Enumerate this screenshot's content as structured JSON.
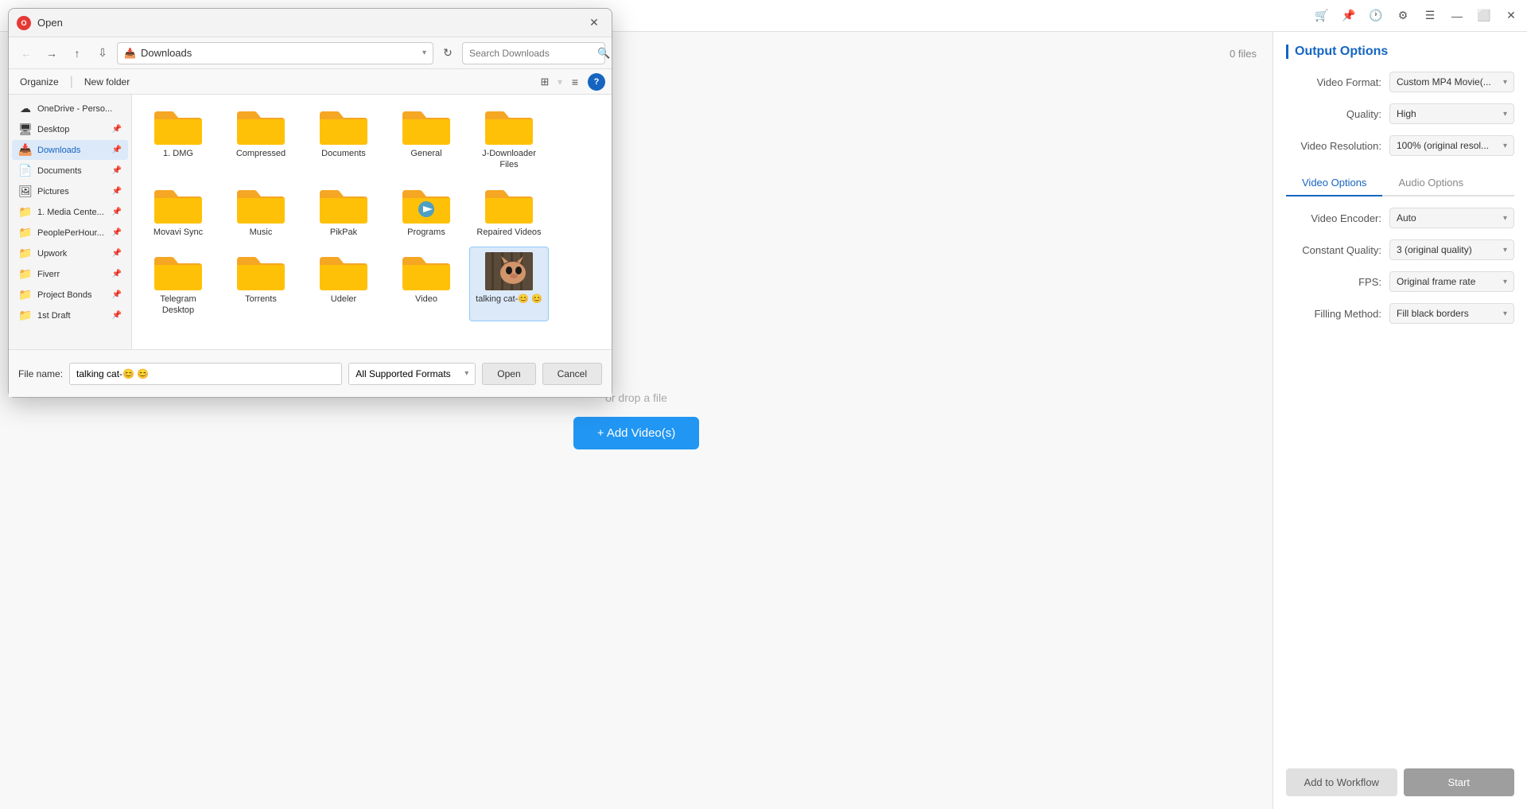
{
  "app": {
    "title": "Open",
    "titlebar_icons": [
      "cart-icon",
      "pin-icon",
      "clock-icon",
      "gear-icon",
      "menu-icon",
      "minimize-icon",
      "restore-icon",
      "close-icon"
    ]
  },
  "dialog": {
    "title": "Open",
    "app_icon": "O",
    "address": {
      "path": "Downloads",
      "icon": "📥"
    },
    "search_placeholder": "Search Downloads",
    "actions": {
      "organize": "Organize",
      "new_folder": "New folder"
    },
    "footer": {
      "filename_label": "File name:",
      "filename_value": "talking cat-😊 😊",
      "format_label": "All Supported Formats",
      "open_btn": "Open",
      "cancel_btn": "Cancel"
    }
  },
  "sidebar": {
    "items": [
      {
        "label": "OneDrive - Perso...",
        "icon": "☁",
        "pinned": false,
        "active": false
      },
      {
        "label": "Desktop",
        "icon": "🖥",
        "pinned": true,
        "active": false
      },
      {
        "label": "Downloads",
        "icon": "📥",
        "pinned": true,
        "active": true
      },
      {
        "label": "Documents",
        "icon": "📄",
        "pinned": true,
        "active": false
      },
      {
        "label": "Pictures",
        "icon": "🖼",
        "pinned": true,
        "active": false
      },
      {
        "label": "1. Media Cente...",
        "icon": "📁",
        "pinned": true,
        "active": false
      },
      {
        "label": "PeoplePerHour...",
        "icon": "📁",
        "pinned": true,
        "active": false
      },
      {
        "label": "Upwork",
        "icon": "📁",
        "pinned": true,
        "active": false
      },
      {
        "label": "Fiverr",
        "icon": "📁",
        "pinned": true,
        "active": false
      },
      {
        "label": "Project Bonds",
        "icon": "📁",
        "pinned": true,
        "active": false
      },
      {
        "label": "1st Draft",
        "icon": "📁",
        "pinned": true,
        "active": false
      }
    ]
  },
  "files": {
    "row1": [
      {
        "name": "1. DMG",
        "type": "folder"
      },
      {
        "name": "Compressed",
        "type": "folder"
      },
      {
        "name": "Documents",
        "type": "folder"
      },
      {
        "name": "General",
        "type": "folder"
      },
      {
        "name": "J-Downloader Files",
        "type": "folder"
      }
    ],
    "row2": [
      {
        "name": "Movavi Sync",
        "type": "folder"
      },
      {
        "name": "Music",
        "type": "folder"
      },
      {
        "name": "PikPak",
        "type": "folder"
      },
      {
        "name": "Programs",
        "type": "folder-special"
      },
      {
        "name": "Repaired Videos",
        "type": "folder"
      }
    ],
    "row3": [
      {
        "name": "Telegram Desktop",
        "type": "folder"
      },
      {
        "name": "Torrents",
        "type": "folder"
      },
      {
        "name": "Udeler",
        "type": "folder"
      },
      {
        "name": "Video",
        "type": "folder"
      },
      {
        "name": "talking cat-😊 😊",
        "type": "video",
        "selected": true
      }
    ]
  },
  "right_panel": {
    "title": "Output Options",
    "files_count": "0 files",
    "options": {
      "video_format_label": "Video Format:",
      "video_format_value": "Custom MP4 Movie(...",
      "quality_label": "Quality:",
      "quality_value": "High",
      "video_resolution_label": "Video Resolution:",
      "video_resolution_value": "100% (original resol...",
      "video_encoder_label": "Video Encoder:",
      "video_encoder_value": "Auto",
      "constant_quality_label": "Constant Quality:",
      "constant_quality_value": "3 (original quality)",
      "fps_label": "FPS:",
      "fps_value": "Original frame rate",
      "filling_method_label": "Filling Method:",
      "filling_method_value": "Fill black borders"
    },
    "tabs": {
      "video": "Video Options",
      "audio": "Audio Options"
    },
    "buttons": {
      "workflow": "Add to Workflow",
      "start": "Start"
    }
  },
  "drop_area": {
    "text": "or drop a file",
    "add_btn": "+ Add Video(s)"
  }
}
